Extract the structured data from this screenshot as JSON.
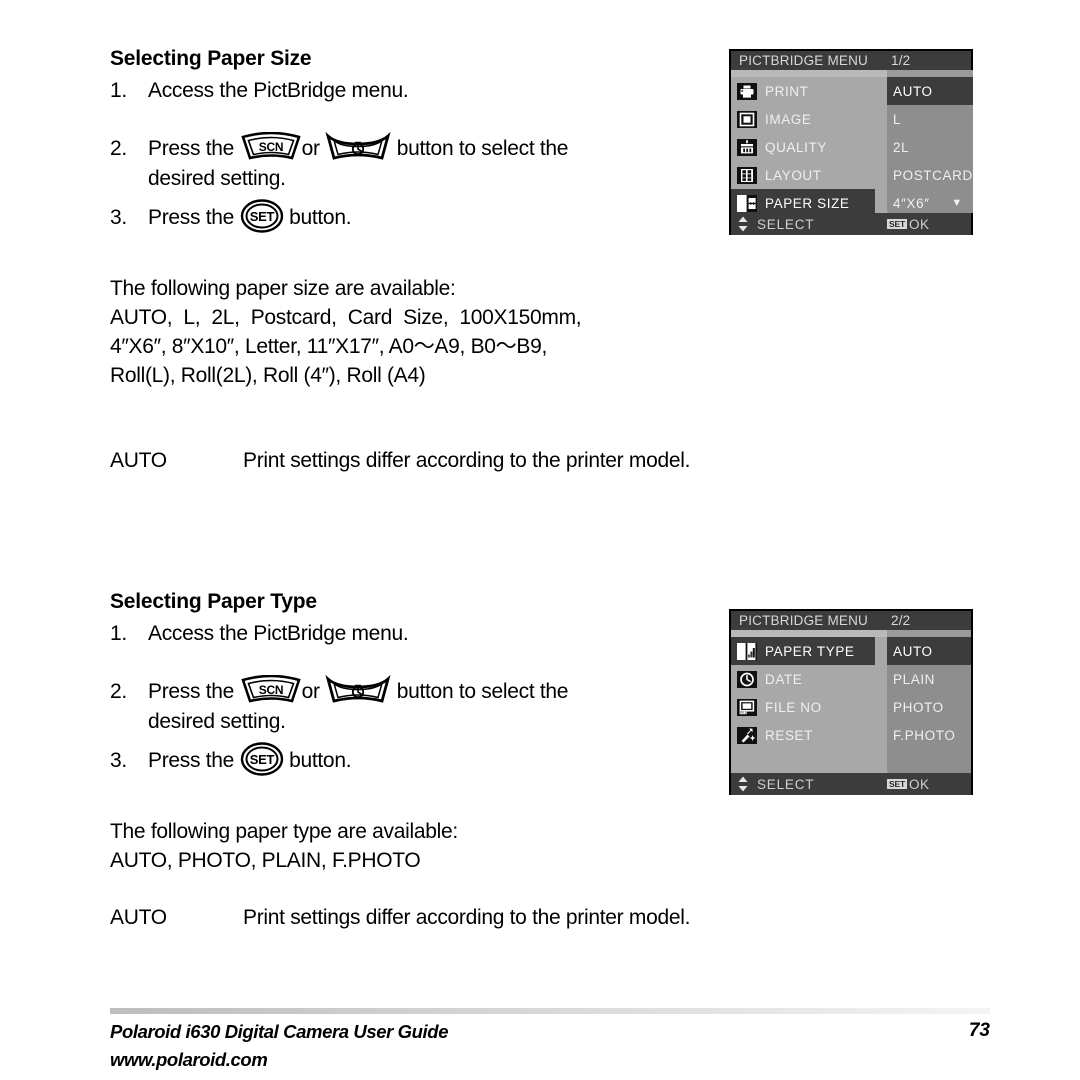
{
  "page": {
    "section1": {
      "heading": "Selecting Paper Size",
      "step1_num": "1.",
      "step1_text": "Access the PictBridge menu.",
      "step2_num": "2.",
      "step2_pre": "Press the",
      "step2_or": "or",
      "step2_post": "button to select the",
      "step2_line2": "desired setting.",
      "step3_num": "3.",
      "step3_pre": "Press the",
      "step3_post": "button.",
      "intro": "The following paper size are available:",
      "list_line1": "AUTO,  L,  2L,  Postcard,  Card  Size,  100X150mm,",
      "list_line2": "4″X6″, 8″X10″, Letter, 11″X17″, A0～A9, B0～B9,",
      "list_line3": "Roll(L), Roll(2L), Roll (4″), Roll (A4)",
      "note_key": "AUTO",
      "note_value": "Print settings differ according to the printer model."
    },
    "section2": {
      "heading": "Selecting Paper Type",
      "step1_num": "1.",
      "step1_text": "Access the PictBridge menu.",
      "step2_num": "2.",
      "step2_pre": "Press the",
      "step2_or": "or",
      "step2_post": "button to select the",
      "step2_line2": "desired setting.",
      "step3_num": "3.",
      "step3_pre": "Press the",
      "step3_post": "button.",
      "intro": "The following paper type are available:",
      "list_line1": "AUTO, PHOTO, PLAIN, F.PHOTO",
      "note_key": "AUTO",
      "note_value": "Print settings differ according to the printer model."
    },
    "buttons": {
      "scn_label": "SCN",
      "set_label": "SET",
      "timer_name": "self-timer-button"
    },
    "menu1": {
      "title": "PICTBRIDGE MENU",
      "page_indicator": "1/2",
      "items": [
        {
          "label": "PRINT",
          "icon": "printer-icon",
          "selected": false
        },
        {
          "label": "IMAGE",
          "icon": "image-icon",
          "selected": false
        },
        {
          "label": "QUALITY",
          "icon": "quality-icon",
          "selected": false
        },
        {
          "label": "LAYOUT",
          "icon": "layout-icon",
          "selected": false
        },
        {
          "label": "PAPER SIZE",
          "icon": "paper-size-icon",
          "selected": true
        }
      ],
      "values": [
        {
          "label": "AUTO",
          "selected": true,
          "caret": false
        },
        {
          "label": "L",
          "selected": false,
          "caret": false
        },
        {
          "label": "2L",
          "selected": false,
          "caret": false
        },
        {
          "label": "POSTCARD",
          "selected": false,
          "caret": false
        },
        {
          "label": "4″X6″",
          "selected": false,
          "caret": true
        }
      ],
      "caret_glyph": "▼",
      "bottom_label": "SELECT",
      "bottom_badge": "SET",
      "bottom_ok": "OK"
    },
    "menu2": {
      "title": "PICTBRIDGE MENU",
      "page_indicator": "2/2",
      "items": [
        {
          "label": "PAPER TYPE",
          "icon": "paper-type-icon",
          "selected": true
        },
        {
          "label": "DATE",
          "icon": "clock-icon",
          "selected": false
        },
        {
          "label": "FILE NO",
          "icon": "file-no-icon",
          "selected": false
        },
        {
          "label": "RESET",
          "icon": "reset-icon",
          "selected": false
        }
      ],
      "values": [
        {
          "label": "AUTO",
          "selected": true,
          "caret": false
        },
        {
          "label": "PLAIN",
          "selected": false,
          "caret": false
        },
        {
          "label": "PHOTO",
          "selected": false,
          "caret": false
        },
        {
          "label": "F.PHOTO",
          "selected": false,
          "caret": false
        }
      ],
      "bottom_label": "SELECT",
      "bottom_badge": "SET",
      "bottom_ok": "OK"
    },
    "footer": {
      "line1": "Polaroid i630 Digital Camera User Guide",
      "line2": "www.polaroid.com",
      "page_number": "73"
    },
    "colors": {
      "lcd_title_bg": "#3c3c3c",
      "lcd_left_bg": "#a8a8a8",
      "lcd_right_bg": "#8e8e8e",
      "highlight_bg": "#3c3c3c",
      "text": "#000000"
    }
  }
}
